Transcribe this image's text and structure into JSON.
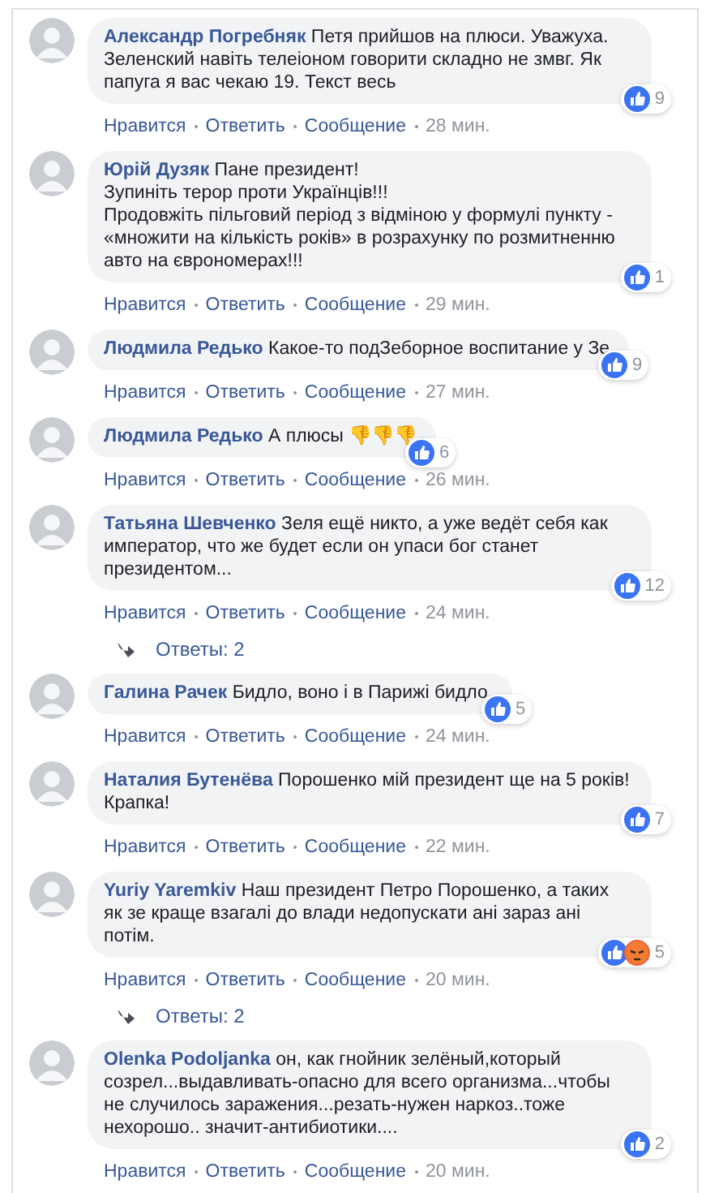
{
  "comments": [
    {
      "author": "Александр Погребняк",
      "text": "Петя прийшов на плюси. Уважуха. Зеленский навіть телеіоном говорити складно не змвг. Як папуга я вас чекаю 19. Текст весь",
      "reactions": [
        {
          "kind": "like"
        }
      ],
      "reaction_count": "9",
      "actions": [
        "Нравится",
        "Ответить",
        "Сообщение"
      ],
      "time": "28 мин."
    },
    {
      "author": "Юрій Дузяк",
      "text": "Пане президент!\nЗупиніть терор проти Українців!!!\nПродовжіть пільговий період з відміною у формулі пункту - «множити на кількість років» в розрахунку по розмитненню авто на єврономерах!!!",
      "reactions": [
        {
          "kind": "like"
        }
      ],
      "reaction_count": "1",
      "actions": [
        "Нравится",
        "Ответить",
        "Сообщение"
      ],
      "time": "29 мин."
    },
    {
      "author": "Людмила Редько",
      "text": "Какое-то подЗеборное воспитание у Зе",
      "reactions": [
        {
          "kind": "like"
        }
      ],
      "reaction_count": "9",
      "actions": [
        "Нравится",
        "Ответить",
        "Сообщение"
      ],
      "time": "27 мин."
    },
    {
      "author": "Людмила Редько",
      "text": "А плюсы 👎👎👎",
      "reactions": [
        {
          "kind": "like"
        }
      ],
      "reaction_count": "6",
      "actions": [
        "Нравится",
        "Ответить",
        "Сообщение"
      ],
      "time": "26 мин."
    },
    {
      "author": "Татьяна Шевченко",
      "text": "Зеля ещё никто, а уже ведёт себя как император, что же будет если он упаси бог станет президентом...",
      "reactions": [
        {
          "kind": "like"
        }
      ],
      "reaction_count": "12",
      "actions": [
        "Нравится",
        "Ответить",
        "Сообщение"
      ],
      "time": "24 мин.",
      "replies": "Ответы: 2"
    },
    {
      "author": "Галина Рачек",
      "text": "Бидло, воно і в Парижі бидло.",
      "reactions": [
        {
          "kind": "like"
        }
      ],
      "reaction_count": "5",
      "actions": [
        "Нравится",
        "Ответить",
        "Сообщение"
      ],
      "time": "24 мин."
    },
    {
      "author": "Наталия Бутенёва",
      "text": "Порошенко мій президент ще на 5 років!Крапка!",
      "reactions": [
        {
          "kind": "like"
        }
      ],
      "reaction_count": "7",
      "actions": [
        "Нравится",
        "Ответить",
        "Сообщение"
      ],
      "time": "22 мин."
    },
    {
      "author": "Yuriy Yaremkiv",
      "text": "Наш президент Петро Порошенко, а таких як зе краще взагалі до влади недопускати ані зараз ані потім.",
      "reactions": [
        {
          "kind": "like"
        },
        {
          "kind": "angry"
        }
      ],
      "reaction_count": "5",
      "actions": [
        "Нравится",
        "Ответить",
        "Сообщение"
      ],
      "time": "20 мин.",
      "replies": "Ответы: 2"
    },
    {
      "author": "Olenka Podoljanka",
      "text": "он, как гнойник зелёный,который созрел...выдавливать-опасно для всего организма...чтобы не случилось заражения...резать-нужен наркоз..тоже нехорошо.. значит-антибиотики....",
      "reactions": [
        {
          "kind": "like"
        }
      ],
      "reaction_count": "2",
      "actions": [
        "Нравится",
        "Ответить",
        "Сообщение"
      ],
      "time": "20 мин."
    }
  ]
}
